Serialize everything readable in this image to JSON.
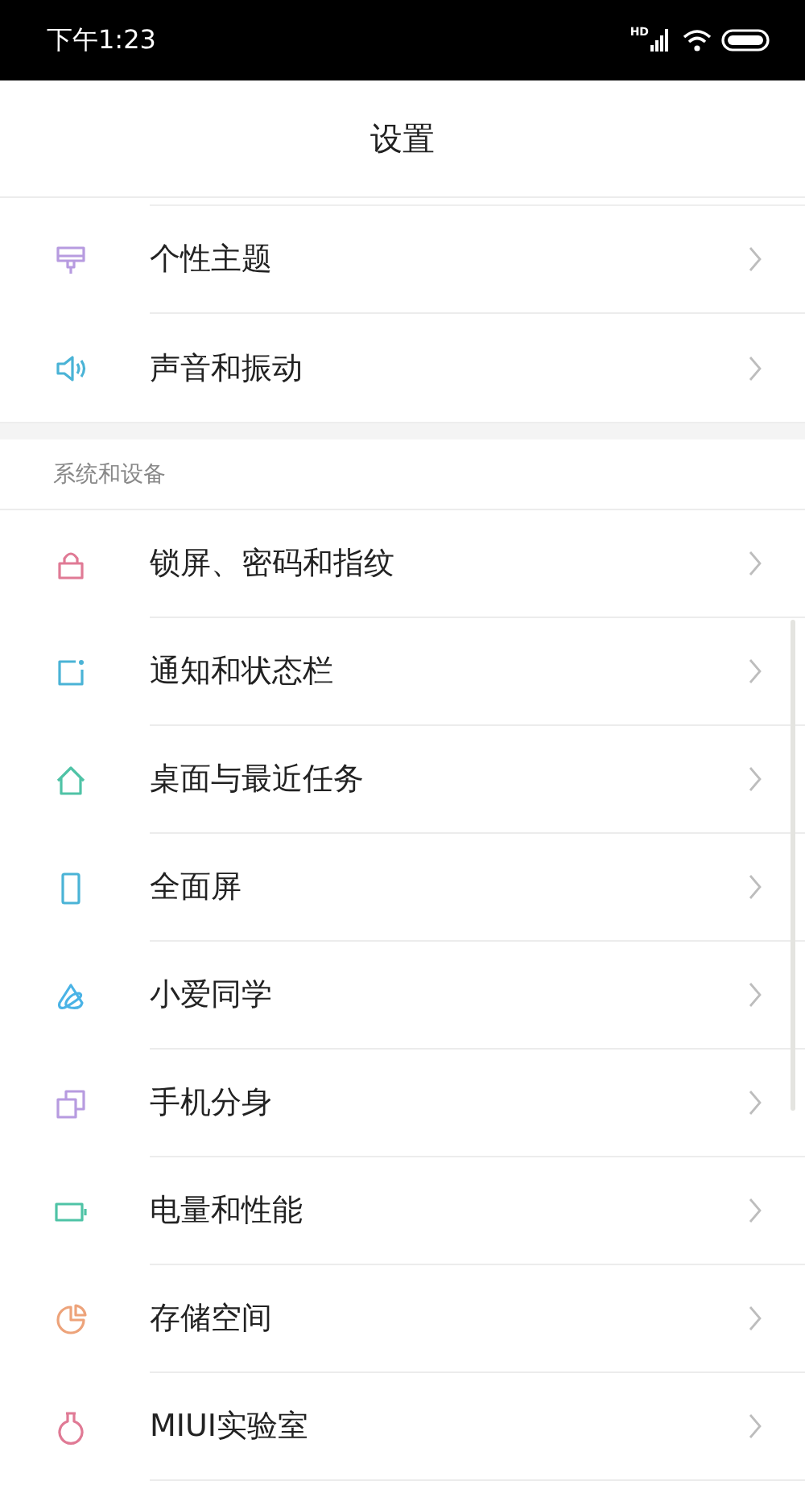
{
  "status_bar": {
    "time": "下午1:23",
    "network_label": "HD"
  },
  "header": {
    "title": "设置"
  },
  "sections": [
    {
      "rows": [
        {
          "label": "个性主题"
        },
        {
          "label": "声音和振动"
        }
      ]
    },
    {
      "title": "系统和设备",
      "rows": [
        {
          "label": "锁屏、密码和指纹"
        },
        {
          "label": "通知和状态栏"
        },
        {
          "label": "桌面与最近任务"
        },
        {
          "label": "全面屏"
        },
        {
          "label": "小爱同学"
        },
        {
          "label": "手机分身"
        },
        {
          "label": "电量和性能"
        },
        {
          "label": "存储空间"
        },
        {
          "label": "MIUI实验室"
        }
      ]
    }
  ]
}
